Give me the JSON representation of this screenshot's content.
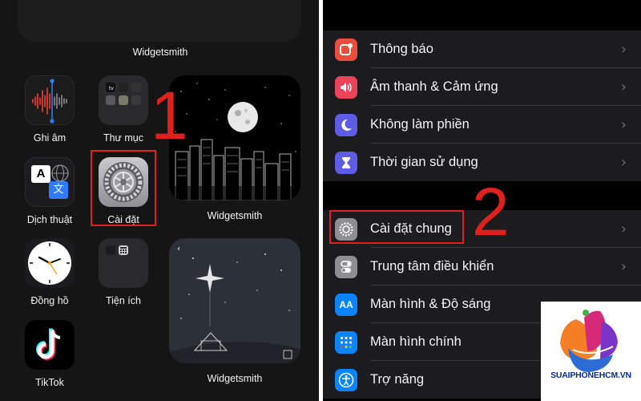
{
  "home": {
    "top_widget_label": "Widgetsmith",
    "apps": {
      "voice_memos": "Ghi âm",
      "folder": "Thư mục",
      "translate": "Dịch thuật",
      "settings": "Cài đặt",
      "clock": "Đồng hồ",
      "utilities": "Tiện ích",
      "tiktok": "TikTok"
    },
    "widget_city_label": "Widgetsmith",
    "widget_nativity_label": "Widgetsmith",
    "translate_glyph_a": "A",
    "translate_glyph_b": "文"
  },
  "settings": {
    "group1": [
      "Thông báo",
      "Âm thanh & Cảm ứng",
      "Không làm phiền",
      "Thời gian sử dụng"
    ],
    "group2": [
      "Cài đặt chung",
      "Trung tâm điều khiển",
      "Màn hình & Độ sáng",
      "Màn hình chính",
      "Trợ năng"
    ],
    "display_icon_text": "AA"
  },
  "annotations": {
    "step1": "1",
    "step2": "2"
  },
  "watermark": "SUAIPHONEHCM.VN",
  "colors": {
    "highlight": "#e0201c",
    "notifications": "#eb4d3d",
    "sounds": "#eb445a",
    "dnd": "#5e5ce6",
    "screen_time": "#5e5ce6",
    "general": "#8e8e93",
    "control_center": "#8e8e93",
    "display": "#0a84ff",
    "home_screen": "#0a84ff",
    "accessibility": "#0a84ff"
  }
}
